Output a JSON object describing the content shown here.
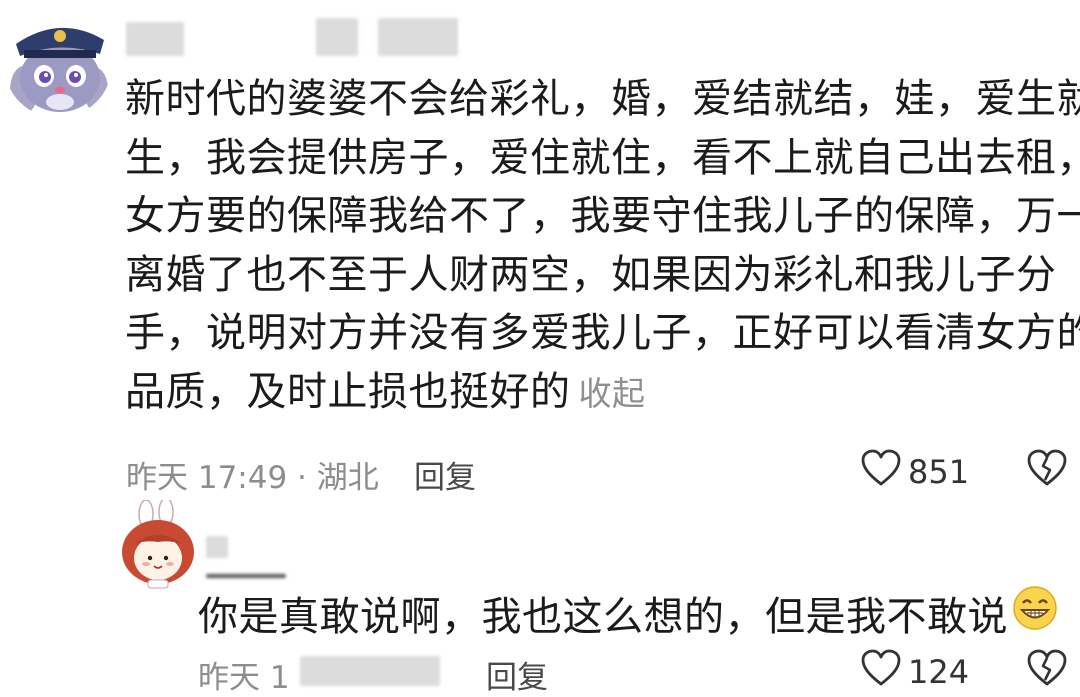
{
  "comment": {
    "lines": [
      "新时代的婆婆不会给彩礼，婚，爱结就结，娃，爱生就",
      "生，我会提供房子，爱住就住，看不上就自己出去租，",
      "女方要的保障我给不了，我要守住我儿子的保障，万一",
      "离婚了也不至于人财两空，如果因为彩礼和我儿子分",
      "手，说明对方并没有多爱我儿子，正好可以看清女方的",
      "品质，及时止损也挺好的"
    ],
    "collapse_label": "收起",
    "meta": "昨天 17:49 · 湖北",
    "reply_label": "回复",
    "like_count": "851"
  },
  "reply": {
    "text": "你是真敢说啊，我也这么想的，但是我不敢说",
    "meta": "昨天 1",
    "reply_label": "回复",
    "like_count": "124"
  },
  "icons": {
    "like": "heart-outline-icon",
    "dislike": "broken-heart-icon",
    "emoji": "grinning-emoji-icon"
  }
}
